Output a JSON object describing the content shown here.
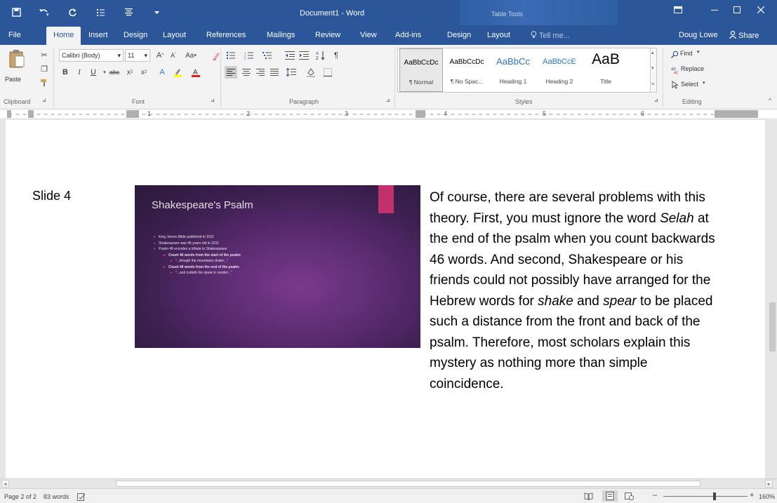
{
  "titlebar": {
    "document_title": "Document1 - Word",
    "contextual_group": "Table Tools",
    "bg_color": "#2b579a"
  },
  "quick_access": [
    "save-icon",
    "undo-icon",
    "redo-icon",
    "touch-mode-icon",
    "format-icon",
    "customize-icon"
  ],
  "tabs": [
    "File",
    "Home",
    "Insert",
    "Design",
    "Layout",
    "References",
    "Mailings",
    "Review",
    "View",
    "Add-ins",
    "Design",
    "Layout"
  ],
  "active_tab": "Home",
  "tell_me": "Tell me...",
  "user": {
    "name": "Doug Lowe",
    "share_label": "Share"
  },
  "ribbon": {
    "clipboard": {
      "paste_label": "Paste",
      "group_label": "Clipboard"
    },
    "font": {
      "font_name": "Calibri (Body)",
      "font_size": "11",
      "change_case": "Aa",
      "group_label": "Font"
    },
    "paragraph": {
      "group_label": "Paragraph"
    },
    "styles": {
      "group_label": "Styles",
      "items": [
        {
          "sample": "AaBbCcDc",
          "name": "¶ Normal"
        },
        {
          "sample": "AaBbCcDc",
          "name": "¶ No Spac..."
        },
        {
          "sample": "AaBbCc",
          "name": "Heading 1"
        },
        {
          "sample": "AaBbCcE",
          "name": "Heading 2"
        },
        {
          "sample": "AaB",
          "name": "Title"
        }
      ]
    },
    "editing": {
      "find": "Find",
      "replace": "Replace",
      "select": "Select",
      "group_label": "Editing"
    }
  },
  "ruler": {
    "numbers": [
      "1",
      "2",
      "3",
      "4",
      "5",
      "6"
    ]
  },
  "document": {
    "slide_label": "Slide 4",
    "slide": {
      "title": "Shakespeare's Psalm",
      "bullets": [
        "King James Bible published in 1611",
        "Shakespeare was 46 years old in 1611",
        "Psalm 46 encodes a tribute to Shakespeare:",
        "Count 46 words from the start of the psalm:",
        "\"...though the mountains shake...\"",
        "Count 46 words from the end of the psalm:",
        "\"...and cutteth the spear in sunder...\""
      ]
    },
    "body": {
      "p1": "Of course, there are several problems with this theory. First, you must ignore the word ",
      "selah": "Selah",
      "p2": " at the end of the psalm when you count backwards 46 words. And second, Shakespeare or his friends could not possibly have arranged for the Hebrew words for ",
      "shake": "shake",
      "p3": " and ",
      "spear": "spear",
      "p4": " to be placed such a distance from the front and back of the psalm. Therefore, most scholars explain this mystery as nothing more than simple coincidence."
    }
  },
  "status": {
    "page": "Page 2 of 2",
    "words": "83 words",
    "zoom": "160%"
  }
}
